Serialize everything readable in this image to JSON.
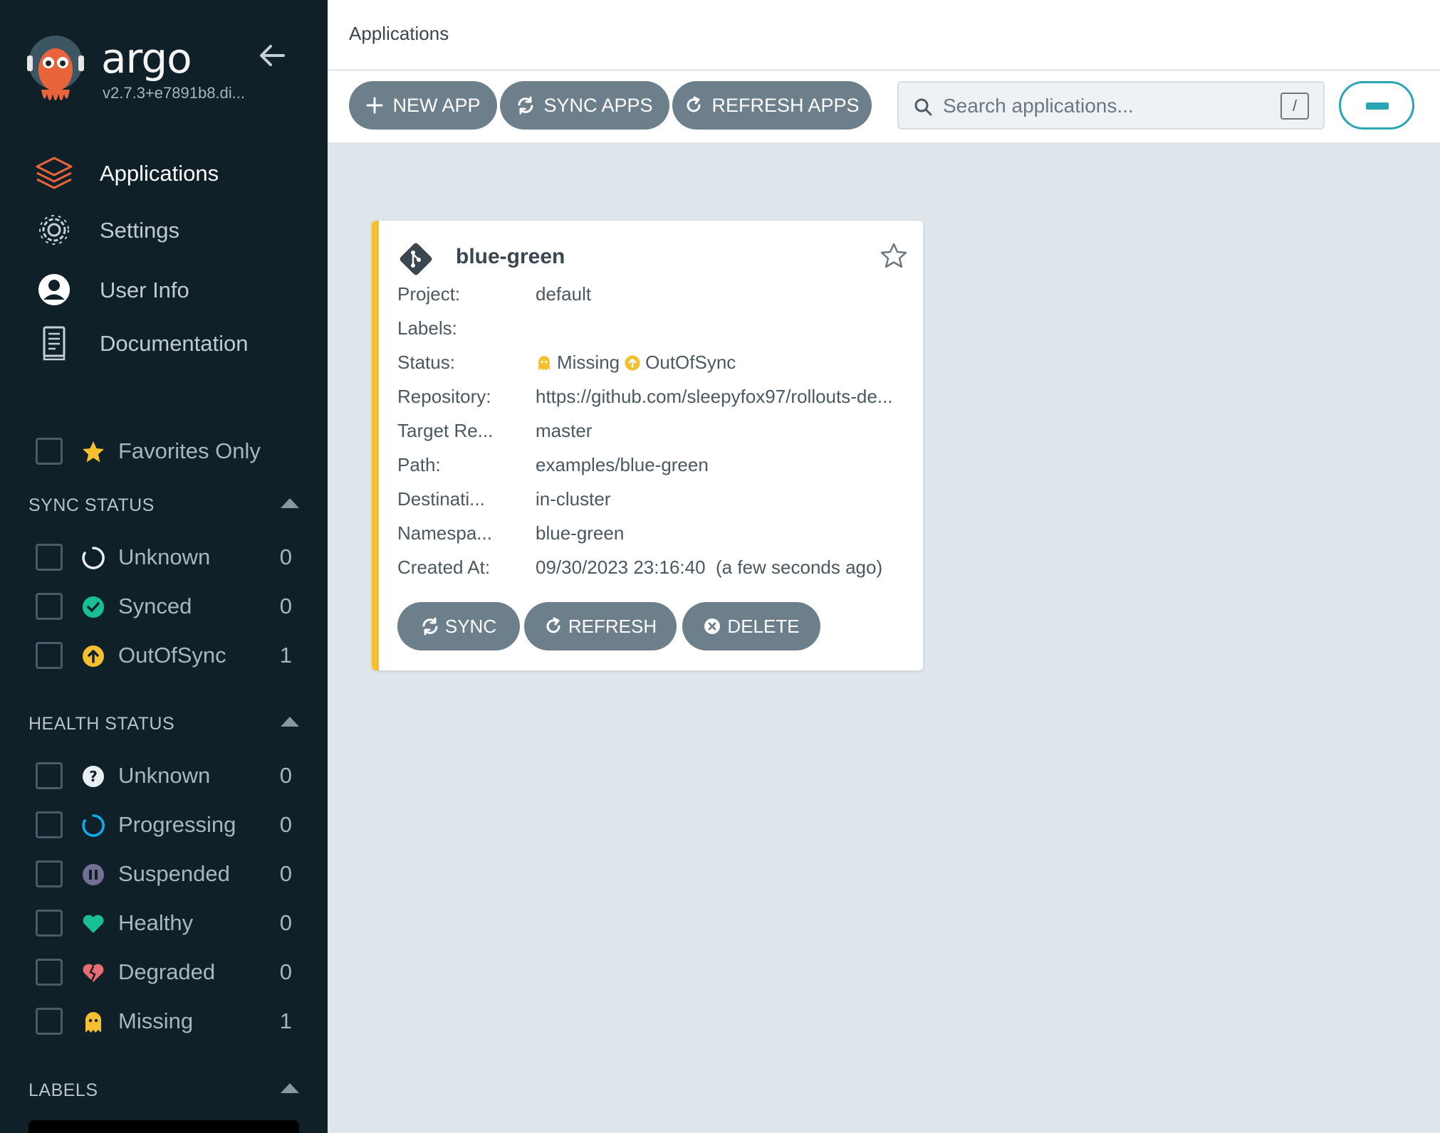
{
  "sidebar": {
    "brand": "argo",
    "version": "v2.7.3+e7891b8.di...",
    "nav": [
      {
        "label": "Applications",
        "icon": "layers-icon"
      },
      {
        "label": "Settings",
        "icon": "gear-icon"
      },
      {
        "label": "User Info",
        "icon": "user-icon"
      },
      {
        "label": "Documentation",
        "icon": "book-icon"
      }
    ],
    "favorites_label": "Favorites Only",
    "sync_status": {
      "title": "SYNC STATUS",
      "items": [
        {
          "label": "Unknown",
          "count": "0",
          "icon": "circle-notch-icon"
        },
        {
          "label": "Synced",
          "count": "0",
          "icon": "check-circle-icon"
        },
        {
          "label": "OutOfSync",
          "count": "1",
          "icon": "arrow-up-circle-icon"
        }
      ]
    },
    "health_status": {
      "title": "HEALTH STATUS",
      "items": [
        {
          "label": "Unknown",
          "count": "0",
          "icon": "question-circle-icon"
        },
        {
          "label": "Progressing",
          "count": "0",
          "icon": "spinner-icon"
        },
        {
          "label": "Suspended",
          "count": "0",
          "icon": "pause-circle-icon"
        },
        {
          "label": "Healthy",
          "count": "0",
          "icon": "heart-icon"
        },
        {
          "label": "Degraded",
          "count": "0",
          "icon": "broken-heart-icon"
        },
        {
          "label": "Missing",
          "count": "1",
          "icon": "ghost-icon"
        }
      ]
    },
    "labels_title": "LABELS"
  },
  "header": {
    "title": "Applications"
  },
  "toolbar": {
    "new_app": "NEW APP",
    "sync_apps": "SYNC APPS",
    "refresh_apps": "REFRESH APPS",
    "search_placeholder": "Search applications...",
    "search_shortcut": "/"
  },
  "app_card": {
    "name": "blue-green",
    "fields": {
      "project_label": "Project:",
      "project": "default",
      "labels_label": "Labels:",
      "labels": "",
      "status_label": "Status:",
      "health": "Missing",
      "sync": "OutOfSync",
      "repo_label": "Repository:",
      "repo": "https://github.com/sleepyfox97/rollouts-de...",
      "target_label": "Target Re...",
      "target": "master",
      "path_label": "Path:",
      "path": "examples/blue-green",
      "dest_label": "Destinati...",
      "dest": "in-cluster",
      "ns_label": "Namespa...",
      "ns": "blue-green",
      "created_label": "Created At:",
      "created": "09/30/2023 23:16:40  (a few seconds ago)"
    },
    "buttons": {
      "sync": "SYNC",
      "refresh": "REFRESH",
      "delete": "DELETE"
    }
  },
  "colors": {
    "sidebar_bg": "#0f2029",
    "accent_teal": "#2aa5b3",
    "button_gray": "#6d7f8b",
    "out_of_sync": "#f4c030",
    "synced": "#18be94",
    "healthy": "#18be94",
    "degraded": "#e96d76",
    "progressing": "#0dadea"
  }
}
